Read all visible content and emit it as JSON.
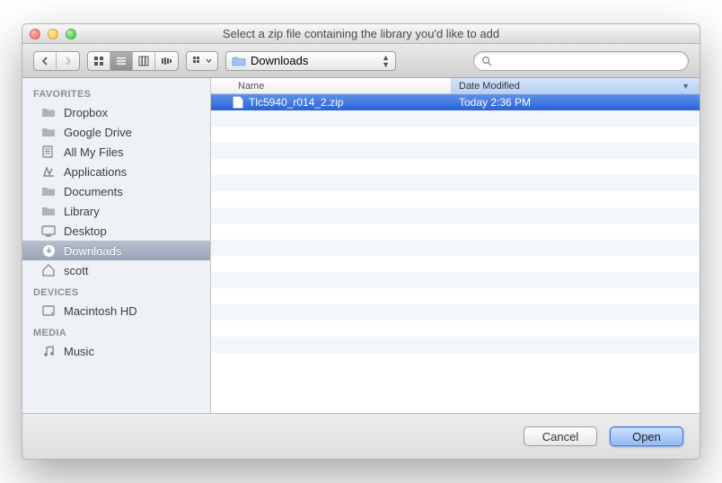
{
  "window": {
    "title": "Select a zip file containing the library you'd like to add"
  },
  "toolbar": {
    "location_label": "Downloads",
    "search_placeholder": ""
  },
  "sidebar": {
    "sections": [
      {
        "header": "FAVORITES",
        "items": [
          {
            "label": "Dropbox",
            "icon": "folder-icon"
          },
          {
            "label": "Google Drive",
            "icon": "folder-icon"
          },
          {
            "label": "All My Files",
            "icon": "allfiles-icon"
          },
          {
            "label": "Applications",
            "icon": "apps-icon"
          },
          {
            "label": "Documents",
            "icon": "folder-icon"
          },
          {
            "label": "Library",
            "icon": "folder-icon"
          },
          {
            "label": "Desktop",
            "icon": "desktop-icon"
          },
          {
            "label": "Downloads",
            "icon": "downloads-icon",
            "selected": true
          },
          {
            "label": "scott",
            "icon": "home-icon"
          }
        ]
      },
      {
        "header": "DEVICES",
        "items": [
          {
            "label": "Macintosh HD",
            "icon": "disk-icon"
          }
        ]
      },
      {
        "header": "MEDIA",
        "items": [
          {
            "label": "Music",
            "icon": "music-icon"
          }
        ]
      }
    ]
  },
  "columns": {
    "name": "Name",
    "date": "Date Modified"
  },
  "files": [
    {
      "name": "Tlc5940_r014_2.zip",
      "date": "Today 2:36 PM",
      "selected": true
    }
  ],
  "footer": {
    "cancel": "Cancel",
    "open": "Open"
  }
}
